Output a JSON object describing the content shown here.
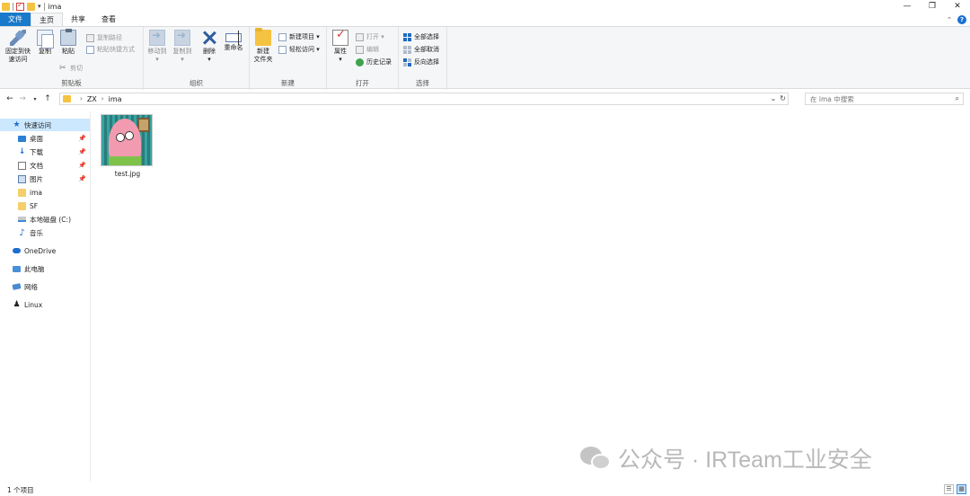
{
  "window": {
    "title": "ima",
    "controls": {
      "minimize": "—",
      "maximize": "❐",
      "close": "✕"
    }
  },
  "ribbon_tabs": [
    {
      "label": "文件"
    },
    {
      "label": "主页"
    },
    {
      "label": "共享"
    },
    {
      "label": "查看"
    }
  ],
  "ribbon": {
    "clipboard": {
      "pin_label_1": "固定到快",
      "pin_label_2": "速访问",
      "copy_label": "复制",
      "paste_label": "粘贴",
      "copy_path_label": "复制路径",
      "paste_shortcut_label": "粘贴快捷方式",
      "cut_label": "剪切",
      "group_label": "剪贴板"
    },
    "organize": {
      "move_to_label": "移动到",
      "copy_to_label": "复制到",
      "delete_label": "删除",
      "rename_label": "重命名",
      "group_label": "组织"
    },
    "new": {
      "new_folder_label_1": "新建",
      "new_folder_label_2": "文件夹",
      "new_item_label": "新建项目 ▾",
      "easy_access_label": "轻松访问 ▾",
      "group_label": "新建"
    },
    "open": {
      "properties_label": "属性",
      "open_label": "打开 ▾",
      "edit_label": "编辑",
      "history_label": "历史记录",
      "group_label": "打开"
    },
    "select": {
      "select_all_label": "全部选择",
      "select_none_label": "全部取消",
      "invert_label": "反向选择",
      "group_label": "选择"
    }
  },
  "navigation": {
    "path": [
      "ZX",
      "ima"
    ],
    "search_placeholder": "在 ima 中搜索"
  },
  "sidebar": {
    "items": [
      {
        "label": "快速访问",
        "icon": "star-icon"
      },
      {
        "label": "桌面",
        "icon": "desktop-icon",
        "pinned": true
      },
      {
        "label": "下载",
        "icon": "download-icon",
        "pinned": true
      },
      {
        "label": "文档",
        "icon": "documents-icon",
        "pinned": true
      },
      {
        "label": "图片",
        "icon": "pictures-icon",
        "pinned": true
      },
      {
        "label": "ima",
        "icon": "folder-icon"
      },
      {
        "label": "SF",
        "icon": "folder-icon"
      },
      {
        "label": "本地磁盘 (C:)",
        "icon": "drive-icon"
      },
      {
        "label": "音乐",
        "icon": "music-icon"
      },
      {
        "label": "OneDrive",
        "icon": "onedrive-icon"
      },
      {
        "label": "此电脑",
        "icon": "computer-icon"
      },
      {
        "label": "网络",
        "icon": "network-icon"
      },
      {
        "label": "Linux",
        "icon": "linux-icon"
      }
    ]
  },
  "files": [
    {
      "name": "test.jpg"
    }
  ],
  "status": {
    "item_count": "1 个项目"
  },
  "watermark": {
    "text": "公众号 · IRTeam工业安全"
  }
}
